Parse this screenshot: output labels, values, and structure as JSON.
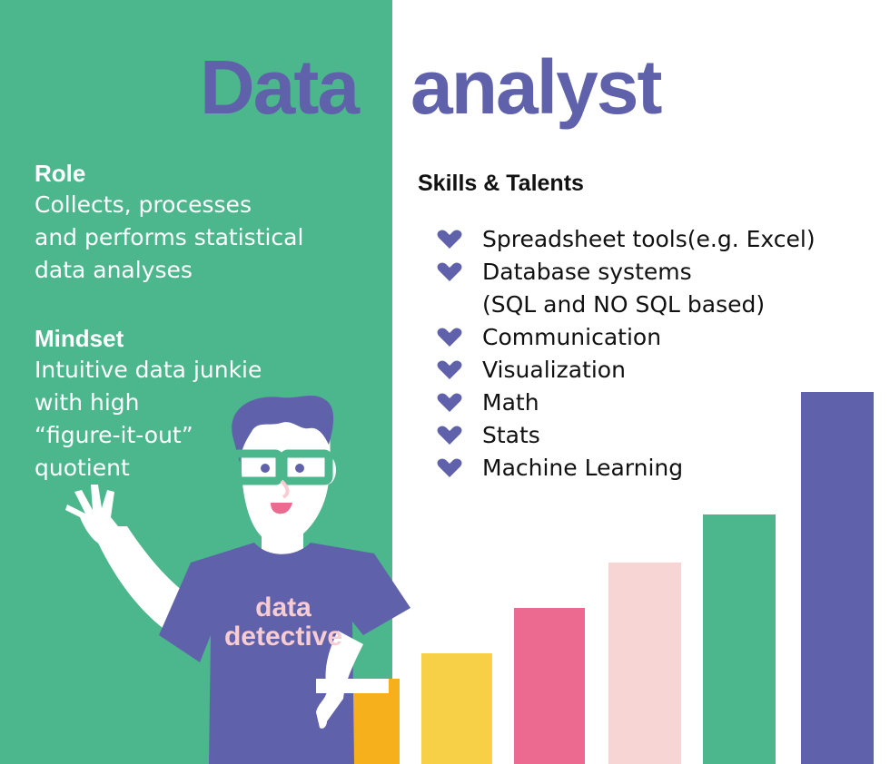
{
  "title": {
    "word1": "Data",
    "word2": "analyst"
  },
  "role": {
    "heading": "Role",
    "text": "Collects, processes\nand performs statistical\ndata analyses"
  },
  "mindset": {
    "heading": "Mindset",
    "text": "Intuitive data junkie\nwith high\n“figure-it-out”\nquotient"
  },
  "skills": {
    "heading": "Skills & Talents",
    "items": [
      "Spreadsheet tools(e.g. Excel)",
      "Database systems\n(SQL and NO SQL based)",
      "Communication",
      "Visualization",
      "Math",
      "Stats",
      "Machine Learning"
    ],
    "bullet_icon": "heart-icon"
  },
  "character": {
    "shirt_text": "data\ndetective",
    "eyewear_icon": "glasses-icon"
  },
  "colors": {
    "green": "#4cb68c",
    "purple": "#5f62ab",
    "orange": "#f5b01c",
    "yellow": "#f8d048",
    "pink": "#ec6a8f",
    "light_pink": "#f8d5d5"
  }
}
